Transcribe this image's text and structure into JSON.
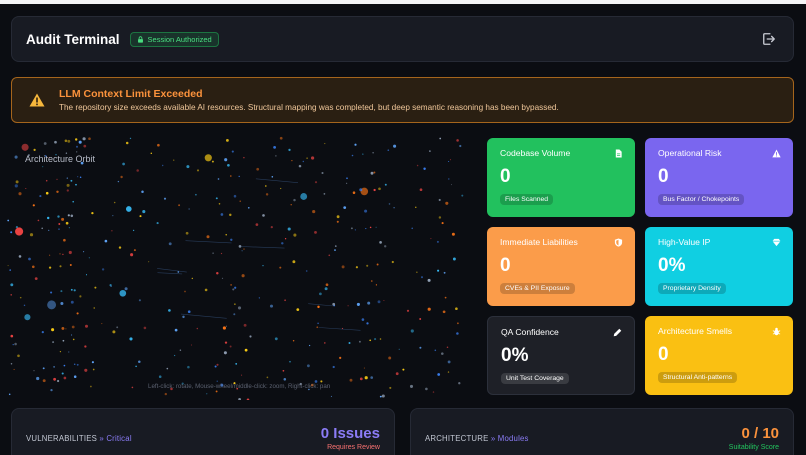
{
  "header": {
    "title": "Audit Terminal",
    "session_badge": "Session Authorized",
    "logout_icon": "logout-icon"
  },
  "alert": {
    "icon": "warning-icon",
    "title": "LLM Context Limit Exceeded",
    "message": "The repository size exceeds available AI resources. Structural mapping was completed, but deep semantic reasoning has been bypassed."
  },
  "orbit": {
    "label": "Architecture Orbit",
    "hint": "Left-click: rotate, Mouse-wheel/middle-click: zoom, Right-click: pan"
  },
  "cards": [
    {
      "title": "Codebase Volume",
      "value": "0",
      "pill": "Files Scanned",
      "icon": "file-icon",
      "color": "#22c15e"
    },
    {
      "title": "Operational Risk",
      "value": "0",
      "pill": "Bus Factor / Chokepoints",
      "icon": "warning-icon",
      "color": "#7a66ef"
    },
    {
      "title": "Immediate Liabilities",
      "value": "0",
      "pill": "CVEs & PII Exposure",
      "icon": "shield-icon",
      "color": "#fb9c4a"
    },
    {
      "title": "High-Value IP",
      "value": "0%",
      "pill": "Proprietary Density",
      "icon": "gem-icon",
      "color": "#10cfe2"
    },
    {
      "title": "QA Confidence",
      "value": "0%",
      "pill": "Unit Test Coverage",
      "icon": "pencil-icon",
      "color": "#1e2027"
    },
    {
      "title": "Architecture Smells",
      "value": "0",
      "pill": "Structural Anti-patterns",
      "icon": "bug-icon",
      "color": "#fac012"
    }
  ],
  "panels": {
    "vulnerabilities": {
      "label": "VULNERABILITIES",
      "separator": "»",
      "accent": "Critical",
      "value": "0 Issues",
      "sub": "Requires Review"
    },
    "architecture": {
      "label": "ARCHITECTURE",
      "separator": "»",
      "accent": "Modules",
      "value": "0 / 10",
      "sub": "Suitability Score"
    }
  }
}
